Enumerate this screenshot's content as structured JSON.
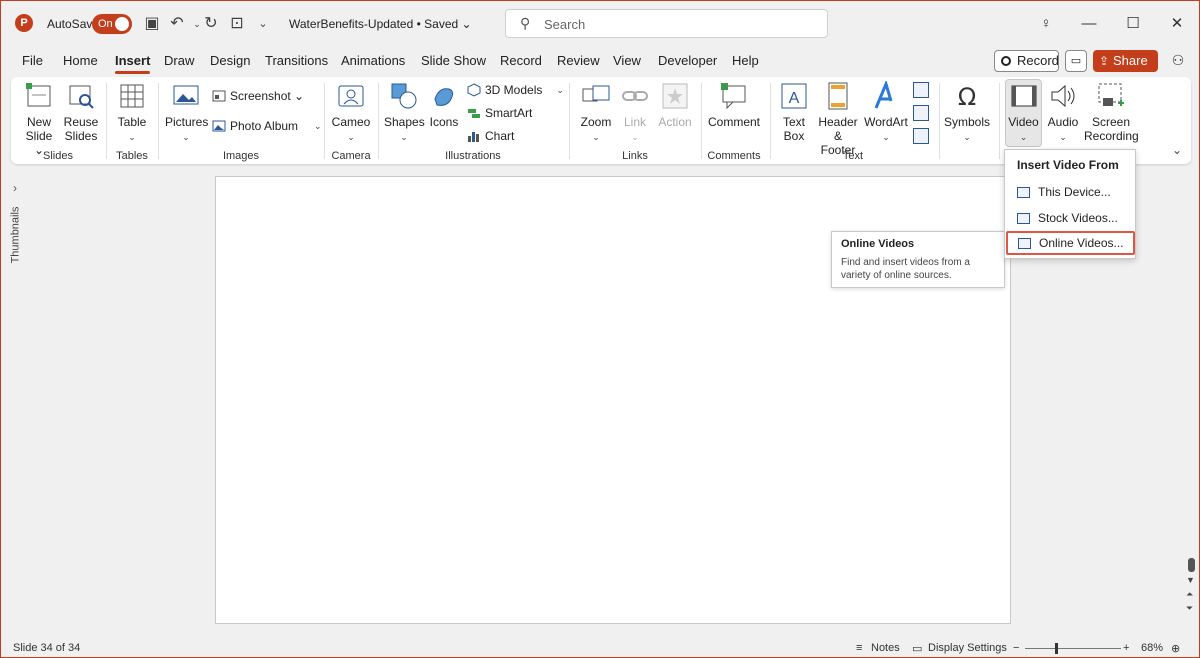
{
  "titlebar": {
    "logo": "P",
    "autosave_label": "AutoSave",
    "autosave_state": "On",
    "doc_title": "WaterBenefits-Updated • Saved ⌄",
    "search_placeholder": "Search"
  },
  "menu": {
    "tabs": [
      "File",
      "Home",
      "Insert",
      "Draw",
      "Design",
      "Transitions",
      "Animations",
      "Slide Show",
      "Record",
      "Review",
      "View",
      "Developer",
      "Help"
    ],
    "active_tab": "Insert",
    "record_label": "Record",
    "share_label": "Share"
  },
  "ribbon": {
    "new_slide": [
      "New",
      "Slide ⌄"
    ],
    "reuse_slides": [
      "Reuse",
      "Slides"
    ],
    "table": "Table",
    "pictures": "Pictures",
    "screenshot": "Screenshot ⌄",
    "photo_album": "Photo Album",
    "cameo": "Cameo",
    "shapes": "Shapes",
    "icons": "Icons",
    "models_3d": "3D Models",
    "smartart": "SmartArt",
    "chart": "Chart",
    "zoom": "Zoom",
    "link": "Link",
    "action": "Action",
    "comment": "Comment",
    "text_box": [
      "Text",
      "Box"
    ],
    "header_footer": [
      "Header",
      "& Footer"
    ],
    "wordart": "WordArt",
    "symbols": "Symbols",
    "video": "Video",
    "audio": "Audio",
    "screen_recording": [
      "Screen",
      "Recording"
    ],
    "groups": {
      "slides": "Slides",
      "tables": "Tables",
      "images": "Images",
      "camera": "Camera",
      "illustrations": "Illustrations",
      "links": "Links",
      "comments": "Comments",
      "text": "Text"
    }
  },
  "rail": {
    "label": "Thumbnails"
  },
  "dropdown": {
    "title": "Insert Video From",
    "items": [
      "This Device...",
      "Stock Videos...",
      "Online Videos..."
    ],
    "highlighted": "Online Videos..."
  },
  "tooltip": {
    "title": "Online Videos",
    "body": "Find and insert videos from a variety of online sources."
  },
  "statusbar": {
    "slide_info": "Slide 34 of 34",
    "notes": "Notes",
    "display_settings": "Display Settings",
    "zoom": "68%"
  },
  "colors": {
    "accent": "#c43e1c",
    "highlight_border": "#e05544",
    "icon_blue": "#2b5797"
  }
}
